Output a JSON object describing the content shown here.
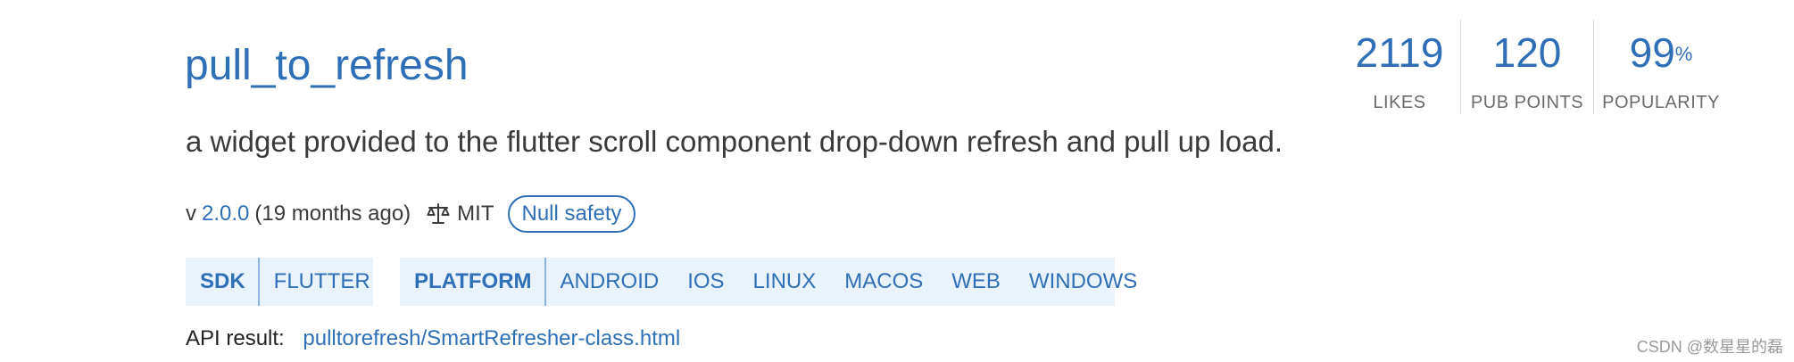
{
  "package": {
    "title": "pull_to_refresh",
    "description": "a widget provided to the flutter scroll component drop-down refresh and pull up load."
  },
  "meta": {
    "version_prefix": "v",
    "version": "2.0.0",
    "age": "(19 months ago)",
    "license_icon": "scale-balance-icon",
    "license": "MIT",
    "null_safety": "Null safety"
  },
  "tags": {
    "sdk": {
      "header": "SDK",
      "values": [
        "FLUTTER"
      ]
    },
    "platform": {
      "header": "PLATFORM",
      "values": [
        "ANDROID",
        "IOS",
        "LINUX",
        "MACOS",
        "WEB",
        "WINDOWS"
      ]
    }
  },
  "api_result": {
    "label": "API result:",
    "link": "pulltorefresh/SmartRefresher-class.html"
  },
  "stats": {
    "likes": {
      "value": "2119",
      "label": "LIKES"
    },
    "pub_points": {
      "value": "120",
      "label": "PUB POINTS"
    },
    "popularity": {
      "value": "99",
      "unit": "%",
      "label": "POPULARITY"
    }
  },
  "watermark": "CSDN @数星星的磊",
  "colors": {
    "accent": "#2f6fb6",
    "tag_background": "#e9f3fc",
    "text": "#3a3a3a",
    "muted": "#6b6b6b"
  }
}
